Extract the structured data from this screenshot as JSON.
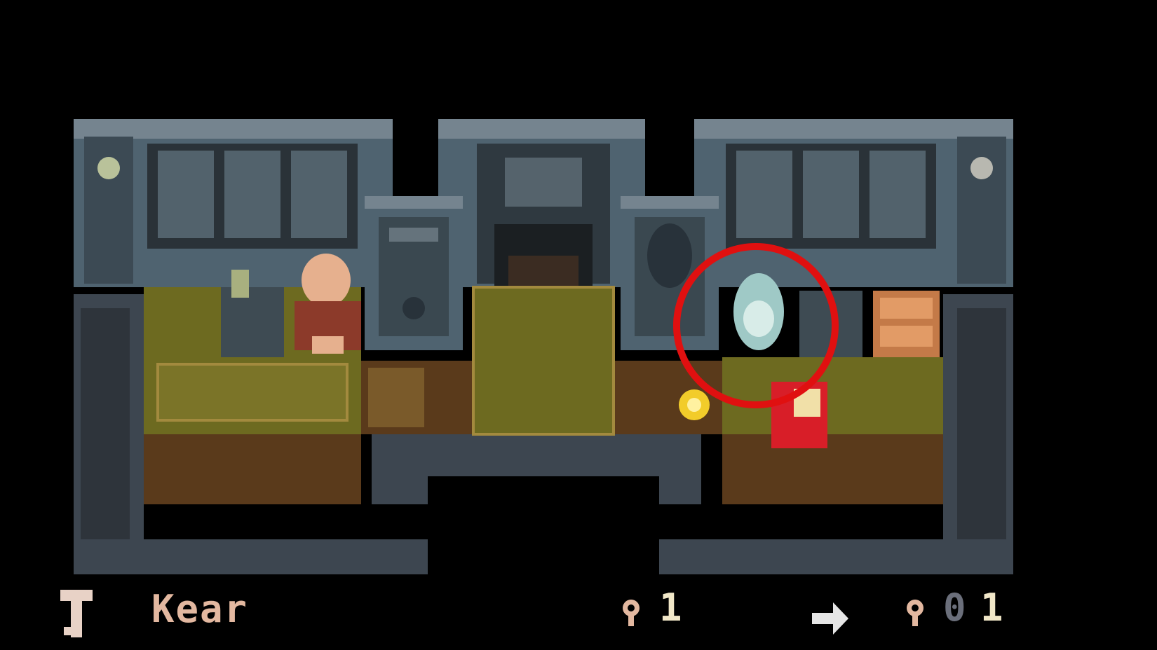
{
  "hud": {
    "item_name": "Kear",
    "key_count": "1",
    "total_lead_digit": "0",
    "total_digit": "1"
  },
  "icons": {
    "held_item": "key-cross-icon",
    "small_key": "small-key-icon",
    "arrow": "right-arrow-icon",
    "total_key": "small-key-icon"
  },
  "colors": {
    "background": "#000000",
    "wall": "#4f6370",
    "wall_light": "#75848f",
    "rug": "#6d6a20",
    "floor_wood": "#5a3a1b",
    "highlight_circle": "#e01010",
    "player": "#d81e28",
    "npc_skin": "#e6b08e"
  }
}
